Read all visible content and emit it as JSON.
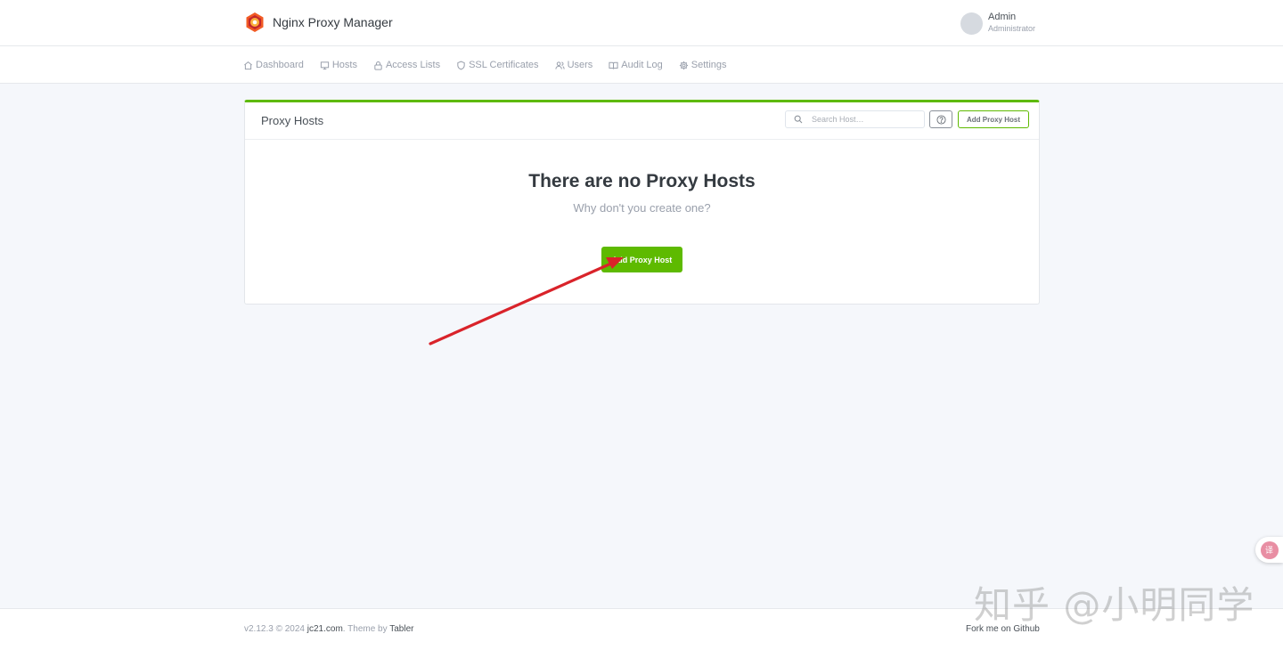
{
  "app": {
    "name": "Nginx Proxy Manager"
  },
  "user": {
    "name": "Admin",
    "role": "Administrator"
  },
  "nav": {
    "items": [
      {
        "label": "Dashboard",
        "icon": "home-icon"
      },
      {
        "label": "Hosts",
        "icon": "monitor-icon"
      },
      {
        "label": "Access Lists",
        "icon": "lock-icon"
      },
      {
        "label": "SSL Certificates",
        "icon": "shield-icon"
      },
      {
        "label": "Users",
        "icon": "users-icon"
      },
      {
        "label": "Audit Log",
        "icon": "book-icon"
      },
      {
        "label": "Settings",
        "icon": "gear-icon"
      }
    ]
  },
  "card": {
    "title": "Proxy Hosts",
    "search_placeholder": "Search Host…",
    "add_button": "Add Proxy Host",
    "empty_title": "There are no Proxy Hosts",
    "empty_subtitle": "Why don't you create one?",
    "empty_add_button": "Add Proxy Host"
  },
  "footer": {
    "version": "v2.12.3 © 2024",
    "company": "jc21.com",
    "theme_prefix": ". Theme by",
    "theme": "Tabler",
    "fork": "Fork me on Github"
  },
  "watermark": "知乎 @小明同学",
  "translate_button": "译",
  "colors": {
    "accent": "#5eba00",
    "annotation": "#d9232a"
  }
}
